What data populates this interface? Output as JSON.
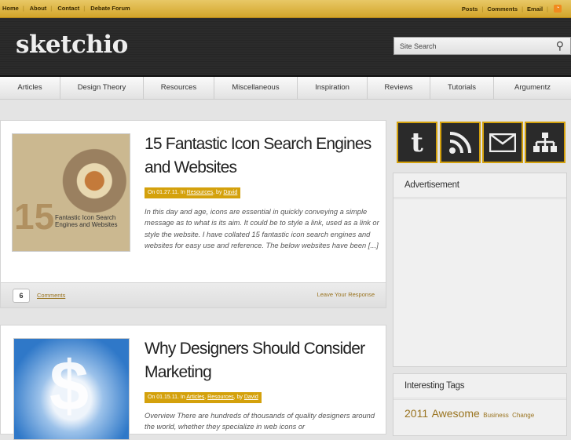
{
  "topbar": {
    "left": [
      "Home",
      "About",
      "Contact",
      "Debate Forum"
    ],
    "right": [
      "Posts",
      "Comments",
      "Email"
    ]
  },
  "header": {
    "logo": "sketchio",
    "search_placeholder": "Site Search"
  },
  "nav": [
    "Articles",
    "Design Theory",
    "Resources",
    "Miscellaneous",
    "Inspiration",
    "Reviews",
    "Tutorials",
    "Argumentz"
  ],
  "posts": [
    {
      "title": "15 Fantastic Icon Search Engines and Websites",
      "meta_prefix": "On 01.27.11. In ",
      "categories": [
        "Resources"
      ],
      "by": ", by ",
      "author": "David",
      "excerpt": "In this day and age, icons are essential in quickly conveying a simple message as to what is its aim. It could be to style a link, used as a link or style the website. I have collated 15 fantastic icon search engines and websites for easy use and reference. The below websites have been [...]",
      "comments_count": "6",
      "comments_label": "Comments",
      "respond_label": "Leave Your Response",
      "thumb_number": "15",
      "thumb_text": "Fantastic Icon Search Engines and Websites"
    },
    {
      "title": "Why Designers Should Consider Marketing",
      "meta_prefix": "On 01.15.11. In ",
      "categories": [
        "Articles",
        "Resources"
      ],
      "by": ", by ",
      "author": "David",
      "excerpt": "Overview There are hundreds of thousands of quality designers around the world, whether they specialize in web icons or"
    }
  ],
  "sidebar": {
    "advertisement": "Advertisement",
    "tags_title": "Interesting Tags",
    "tags": [
      "2011",
      "Awesome",
      "Business",
      "Change"
    ]
  },
  "colors": {
    "accent": "#d4a10c",
    "dark": "#2a2a2a"
  }
}
